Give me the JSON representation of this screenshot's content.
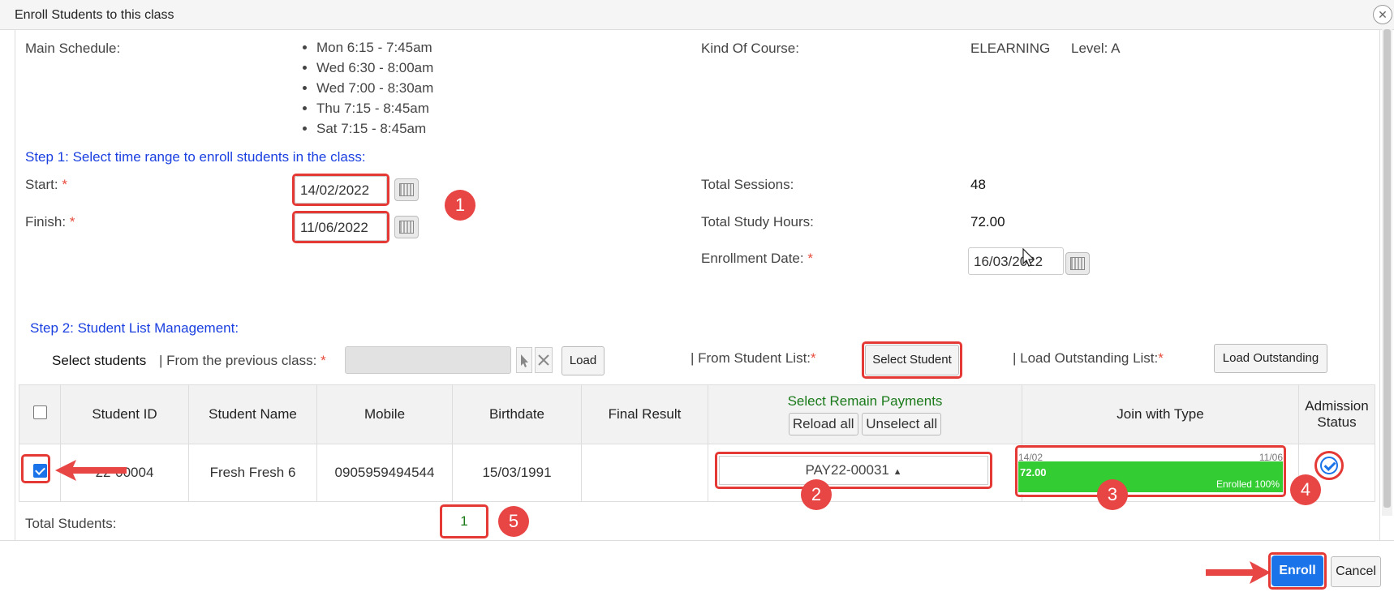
{
  "window": {
    "title": "Enroll Students to this class",
    "close": "✕"
  },
  "schedule": {
    "label": "Main Schedule:",
    "items": [
      "Mon 6:15 - 7:45am",
      "Wed 6:30 - 8:00am",
      "Wed 7:00 - 8:30am",
      "Thu 7:15 - 8:45am",
      "Sat 7:15 - 8:45am"
    ]
  },
  "course": {
    "kind_label": "Kind Of Course:",
    "kind_value": "ELEARNING",
    "level_label": "Level: A"
  },
  "step1": {
    "title": "Step 1: Select time range to enroll students in the class:",
    "start_label": "Start:",
    "start_value": "14/02/2022",
    "finish_label": "Finish:",
    "finish_value": "11/06/2022",
    "required": "*"
  },
  "summary": {
    "sessions_label": "Total Sessions:",
    "sessions_value": "48",
    "hours_label": "Total Study Hours:",
    "hours_value": "72.00",
    "enroll_date_label": "Enrollment Date:",
    "enroll_date_value": "16/03/2022"
  },
  "step2": {
    "title": "Step 2: Student List Management:",
    "select_students": "Select students",
    "from_prev": "| From the previous class:",
    "load": "Load",
    "from_list": "| From Student List:",
    "select_student_btn": "Select Student",
    "load_outstanding_label": "| Load Outstanding List:",
    "load_outstanding_btn": "Load Outstanding"
  },
  "table": {
    "headers": {
      "student_id": "Student ID",
      "student_name": "Student Name",
      "mobile": "Mobile",
      "birthdate": "Birthdate",
      "final_result": "Final Result",
      "payments": "Select Remain Payments",
      "reload_all": "Reload all",
      "unselect_all": "Unselect all",
      "join_type": "Join with Type",
      "admission": "Admission Status"
    },
    "rows": [
      {
        "student_id": "22-00004",
        "student_name": "Fresh Fresh 6",
        "mobile": "0905959494544",
        "birthdate": "15/03/1991",
        "final_result": "",
        "payment": "PAY22-00031",
        "join_start": "14/02",
        "join_end": "11/06",
        "join_hours": "72.00",
        "join_status": "Enrolled 100%",
        "join_progress": 1.0
      }
    ]
  },
  "totals": {
    "label": "Total Students:",
    "value": "1"
  },
  "badges": [
    "1",
    "2",
    "3",
    "4",
    "5"
  ],
  "footer": {
    "enroll": "Enroll",
    "cancel": "Cancel"
  }
}
